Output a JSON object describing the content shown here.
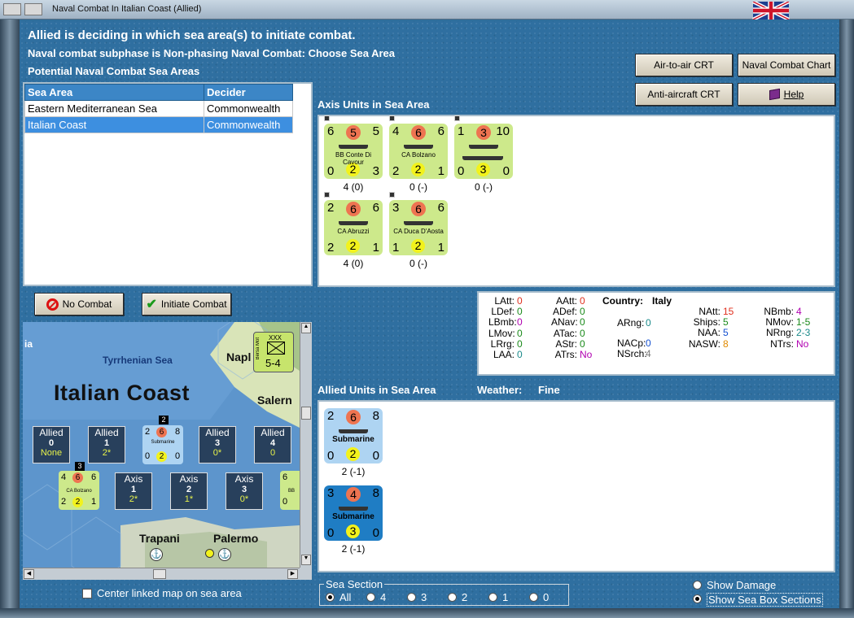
{
  "window": {
    "title": "Naval Combat In Italian Coast (Allied)",
    "flag_icon": "uk-flag-icon"
  },
  "header": {
    "line1": "Allied is deciding in which sea area(s) to initiate combat.",
    "line2": "Naval combat subphase is Non-phasing Naval Combat: Choose Sea Area",
    "line3": "Potential Naval Combat Sea Areas"
  },
  "buttons": {
    "air_to_air": "Air-to-air CRT",
    "naval_chart": "Naval Combat Chart",
    "anti_aircraft": "Anti-aircraft CRT",
    "help": "Help",
    "no_combat": "No Combat",
    "initiate_combat": "Initiate Combat"
  },
  "sea_table": {
    "headers": [
      "Sea Area",
      "Decider"
    ],
    "rows": [
      {
        "area": "Eastern Mediterranean Sea",
        "decider": "Commonwealth"
      },
      {
        "area": "Italian Coast",
        "decider": "Commonwealth"
      }
    ]
  },
  "axis_section": {
    "title": "Axis Units in Sea Area",
    "units": [
      {
        "tl": "6",
        "mid": "5",
        "tr": "5",
        "name": "BB Conte Di Cavour",
        "bl": "0",
        "bm": "2",
        "br": "3",
        "count": "4 (0)"
      },
      {
        "tl": "4",
        "mid": "6",
        "tr": "6",
        "name": "CA Bolzano",
        "bl": "2",
        "bm": "2",
        "br": "1",
        "count": "0 (-)"
      },
      {
        "tl": "1",
        "mid": "3",
        "tr": "10",
        "name": "",
        "bl": "0",
        "bm": "3",
        "br": "0",
        "count": "0 (-)"
      },
      {
        "tl": "2",
        "mid": "6",
        "tr": "6",
        "name": "CA Abruzzi",
        "bl": "2",
        "bm": "2",
        "br": "1",
        "count": "4 (0)"
      },
      {
        "tl": "3",
        "mid": "6",
        "tr": "6",
        "name": "CA Duca D'Aosta",
        "bl": "1",
        "bm": "2",
        "br": "1",
        "count": "0 (-)"
      }
    ]
  },
  "stats": {
    "country_label": "Country:",
    "country": "Italy",
    "col1": [
      [
        "LAtt:",
        "0"
      ],
      [
        "LDef:",
        "0"
      ],
      [
        "LBmb:",
        "0"
      ],
      [
        "LMov:",
        "0"
      ],
      [
        "LRrg:",
        "0"
      ],
      [
        "LAA:",
        "0"
      ]
    ],
    "col2": [
      [
        "AAtt:",
        "0"
      ],
      [
        "ADef:",
        "0"
      ],
      [
        "ANav:",
        "0"
      ],
      [
        "ATac:",
        "0"
      ],
      [
        "AStr:",
        "0"
      ],
      [
        "ATrs:",
        "No"
      ]
    ],
    "col3": [
      [
        "ARng:",
        "0"
      ],
      [
        "NACp:",
        "0"
      ],
      [
        "NSrch:",
        "4"
      ]
    ],
    "col4": [
      [
        "NAtt:",
        "15"
      ],
      [
        "Ships:",
        "5"
      ],
      [
        "NAA:",
        "5"
      ],
      [
        "NASW:",
        "8"
      ]
    ],
    "col5": [
      [
        "NBmb:",
        "4"
      ],
      [
        "NMov:",
        "1-5"
      ],
      [
        "NRng:",
        "2-3"
      ],
      [
        "NTrs:",
        "No"
      ]
    ]
  },
  "allied_section": {
    "title": "Allied Units in Sea Area",
    "weather_label": "Weather:",
    "weather": "Fine",
    "units": [
      {
        "tl": "2",
        "mid": "6",
        "tr": "8",
        "name": "Submarine",
        "bl": "0",
        "bm": "2",
        "br": "0",
        "count": "2 (-1)"
      },
      {
        "tl": "3",
        "mid": "4",
        "tr": "8",
        "name": "Submarine",
        "bl": "0",
        "bm": "3",
        "br": "0",
        "count": "2 (-1)"
      }
    ]
  },
  "map": {
    "title": "Italian Coast",
    "sea_name": "Tyrrhenian Sea",
    "cities": [
      "Napl",
      "Salern",
      "Trapani",
      "Palermo"
    ],
    "edge_label": "ia",
    "corps_counter": {
      "top": "XXX",
      "side": "Bersa Mot",
      "value": "5-4"
    },
    "allied_boxes": [
      {
        "label": "Allied",
        "num": "0",
        "sub": "None"
      },
      {
        "label": "Allied",
        "num": "1",
        "sub": "2*"
      },
      {
        "label": "Allied",
        "num": "3",
        "sub": "0*"
      },
      {
        "label": "Allied",
        "num": "4",
        "sub": "0"
      }
    ],
    "axis_boxes": [
      {
        "label": "Axis",
        "num": "1",
        "sub": "2*"
      },
      {
        "label": "Axis",
        "num": "2",
        "sub": "1*"
      },
      {
        "label": "Axis",
        "num": "3",
        "sub": "0*"
      }
    ],
    "sub_counter": {
      "stack": "2",
      "tl": "2",
      "mid": "6",
      "tr": "8",
      "name": "Submarine",
      "bl": "0",
      "bm": "2",
      "br": "0"
    },
    "bolzano_counter": {
      "stack": "3",
      "tl": "4",
      "mid": "6",
      "tr": "6",
      "name": "CA Bolzano",
      "bl": "2",
      "bm": "2",
      "br": "1"
    },
    "edge_counter": {
      "tl": "6",
      "name": "BB",
      "bl": "0"
    }
  },
  "center_map_label": "Center linked map on sea area",
  "sea_section": {
    "legend": "Sea Section",
    "options": [
      "All",
      "4",
      "3",
      "2",
      "1",
      "0"
    ],
    "selected": "All"
  },
  "display_options": {
    "damage": "Show Damage",
    "sea_box": "Show Sea Box Sections",
    "selected": "sea_box"
  },
  "colors": {
    "panel_bg": "#2f6fa0",
    "unit_green": "#cde98b",
    "unit_blue": "#aed4f2",
    "highlight": "#3d8fe0",
    "red_val": "#e0301e",
    "green_val": "#1a8a1a",
    "purple_val": "#b000b0",
    "teal_val": "#1a8a8a",
    "orange_val": "#e08a00",
    "blue_val": "#1450d0"
  }
}
